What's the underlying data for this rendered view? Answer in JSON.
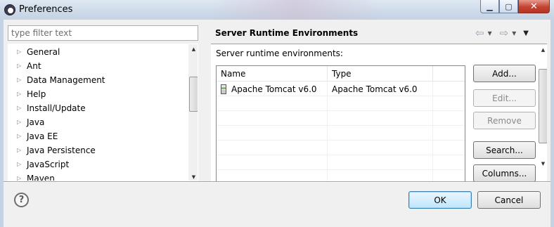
{
  "window": {
    "title": "Preferences",
    "minimize_glyph": "▁",
    "maximize_glyph": "▢",
    "close_glyph": "✕"
  },
  "left": {
    "filter_placeholder": "type filter text",
    "tree_items": [
      {
        "label": "General"
      },
      {
        "label": "Ant"
      },
      {
        "label": "Data Management"
      },
      {
        "label": "Help"
      },
      {
        "label": "Install/Update"
      },
      {
        "label": "Java"
      },
      {
        "label": "Java EE"
      },
      {
        "label": "Java Persistence"
      },
      {
        "label": "JavaScript"
      },
      {
        "label": "Maven"
      }
    ],
    "expand_glyph": "▷"
  },
  "right": {
    "title": "Server Runtime Environments",
    "nav": {
      "back_glyph": "⇦",
      "forward_glyph": "⇨",
      "dropdown_glyph": "▾",
      "menu_glyph": "▼"
    },
    "sub_label": "Server runtime environments:",
    "table": {
      "columns": [
        "Name",
        "Type"
      ],
      "rows": [
        {
          "name": "Apache Tomcat v6.0",
          "type": "Apache Tomcat v6.0",
          "icon": "server-runtime-icon"
        }
      ]
    },
    "buttons": {
      "add": "Add...",
      "edit": "Edit...",
      "remove": "Remove",
      "search": "Search...",
      "columns": "Columns..."
    }
  },
  "bottom": {
    "help_glyph": "?",
    "ok": "OK",
    "cancel": "Cancel"
  },
  "colors": {
    "titlebar": "#cfdbe9",
    "close_button": "#c34332",
    "default_button": "#bee6fd",
    "dialog_bg": "#f0f0f0"
  }
}
